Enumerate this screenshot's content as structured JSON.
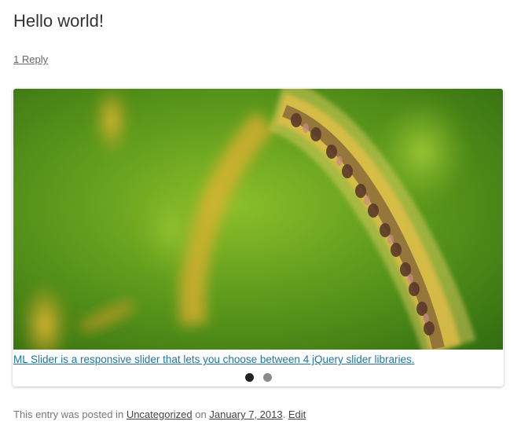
{
  "post": {
    "title": "Hello world!",
    "reply_link": "1 Reply"
  },
  "slider": {
    "image_description_icon": "grass-seedhead-photo",
    "caption": "ML Slider is a responsive slider that lets you choose between 4 jQuery slider libraries.",
    "slide_count": 2,
    "active_slide": 1,
    "colors": {
      "caption_link": "#21759b",
      "dot_active": "#222222",
      "dot_inactive": "#8a8a8a"
    }
  },
  "meta": {
    "prefix": "This entry was posted in",
    "category": "Uncategorized",
    "on_text": "on",
    "date": "January 7, 2013",
    "separator": ".",
    "edit": "Edit"
  }
}
